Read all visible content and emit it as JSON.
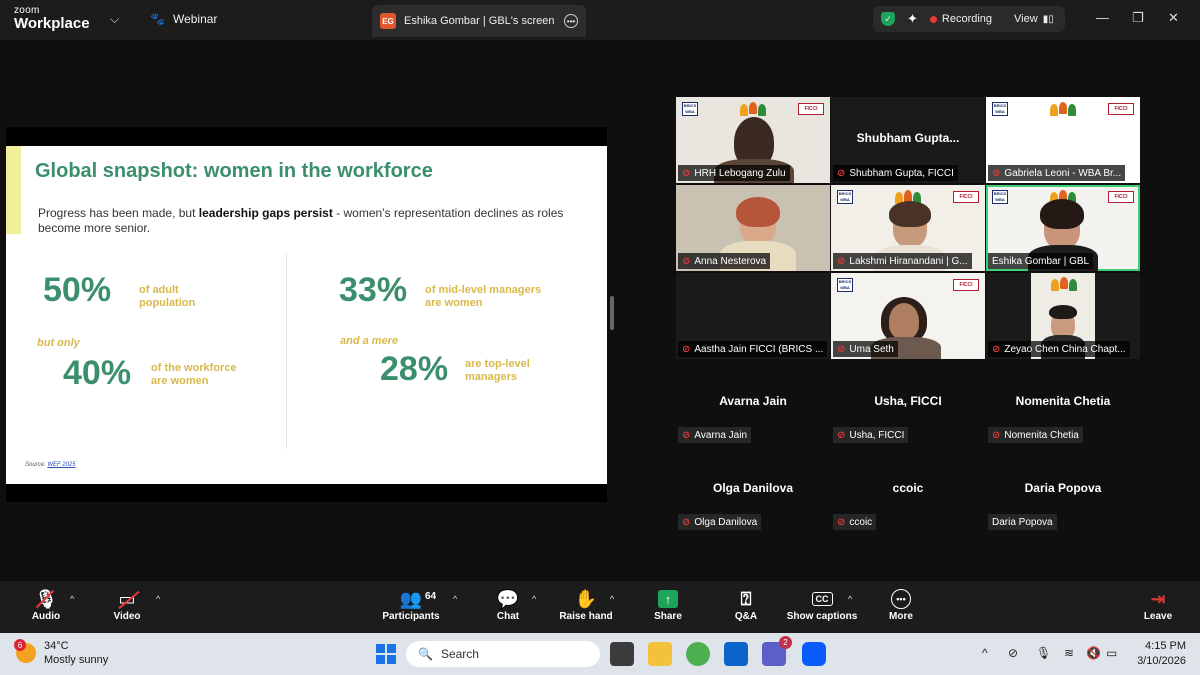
{
  "titlebar": {
    "logo_line1": "zoom",
    "logo_line2": "Workplace",
    "webinar_label": "Webinar",
    "tab_badge": "EG",
    "tab_title": "Eshika Gombar | GBL's screen",
    "recording_label": "Recording",
    "view_label": "View"
  },
  "slide": {
    "title": "Global snapshot: women in the workforce",
    "subtitle_pre": "Progress has been made, but ",
    "subtitle_bold": "leadership gaps persist",
    "subtitle_post": " - women’s representation declines as roles become more senior.",
    "stat1_value": "50%",
    "stat1_desc_1": "of adult",
    "stat1_desc_2": "population",
    "but_only": "but only",
    "stat2_value": "40%",
    "stat2_desc_1": "of the workforce",
    "stat2_desc_2": "are women",
    "stat3_value": "33%",
    "stat3_desc_1": "of mid-level managers",
    "stat3_desc_2": "are women",
    "and_a_mere": "and a mere",
    "stat4_value": "28%",
    "stat4_desc_1": "are top-level",
    "stat4_desc_2": "managers",
    "source_label": "Source: ",
    "source_link": "WEF 2025"
  },
  "gallery": {
    "tiles": [
      {
        "name": "HRH Lebogang Zulu"
      },
      {
        "name": "Shubham Gupta, FICCI",
        "center_name": "Shubham  Gupta..."
      },
      {
        "name": "Gabriela Leoni - WBA Br..."
      },
      {
        "name": "Anna Nesterova"
      },
      {
        "name": "Lakshmi Hiranandani | G..."
      },
      {
        "name": "Eshika Gombar | GBL"
      },
      {
        "name": "Aastha Jain FICCI (BRICS ..."
      },
      {
        "name": "Uma Seth"
      },
      {
        "name": "Zeyao Chen China Chapt..."
      }
    ],
    "audio_only": [
      {
        "title": "Avarna Jain",
        "plate": "Avarna Jain"
      },
      {
        "title": "Usha, FICCI",
        "plate": "Usha, FICCI"
      },
      {
        "title": "Nomenita Chetia",
        "plate": "Nomenita Chetia"
      },
      {
        "title": "Olga Danilova",
        "plate": "Olga Danilova"
      },
      {
        "title": "ccoic",
        "plate": "ccoic"
      },
      {
        "title": "Daria Popova",
        "plate": "Daria Popova"
      }
    ],
    "banner_left": "BRICS WBA",
    "banner_right": "FICCI"
  },
  "toolbar": {
    "audio": "Audio",
    "video": "Video",
    "participants": "Participants",
    "participants_count": "64",
    "chat": "Chat",
    "raise_hand": "Raise hand",
    "share": "Share",
    "qa": "Q&A",
    "show_captions": "Show captions",
    "captions_icon": "CC",
    "more": "More",
    "leave": "Leave"
  },
  "taskbar": {
    "weather_badge": "6",
    "temperature": "34°C",
    "condition": "Mostly sunny",
    "search_placeholder": "Search",
    "teams_badge": "2",
    "time": "4:15 PM",
    "date": "3/10/2026"
  },
  "colors": {
    "slide_green": "#3b8f6d",
    "slide_gold": "#d9b94a",
    "active_speaker": "#3ccf7a",
    "recording_red": "#e53935"
  }
}
